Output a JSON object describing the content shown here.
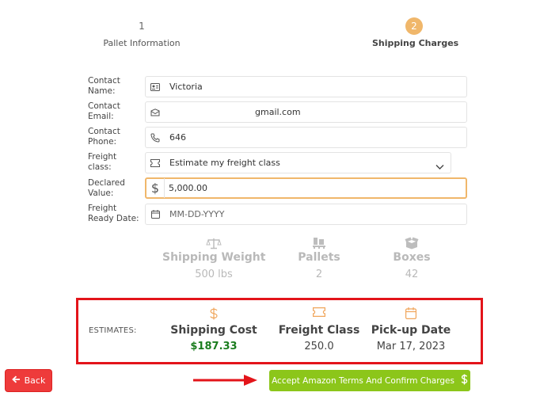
{
  "stepper": {
    "step1": {
      "number": "1",
      "label": "Pallet Information"
    },
    "step2": {
      "number": "2",
      "label": "Shipping Charges"
    }
  },
  "form": {
    "contact_name": {
      "label": "Contact Name:",
      "value": "Victoria",
      "icon": "id-card-icon"
    },
    "contact_email": {
      "label": "Contact Email:",
      "value": "gmail.com",
      "icon": "envelope-icon"
    },
    "contact_phone": {
      "label": "Contact Phone:",
      "value": "646",
      "icon": "phone-icon"
    },
    "freight_class": {
      "label": "Freight class:",
      "value": "Estimate my freight class",
      "icon": "ticket-icon"
    },
    "declared_value": {
      "label": "Declared Value:",
      "value": "5,000.00",
      "prefix": "$"
    },
    "freight_ready_date": {
      "label": "Freight Ready Date:",
      "placeholder": "MM-DD-YYYY",
      "icon": "calendar-icon"
    }
  },
  "summary": {
    "shipping_weight": {
      "title": "Shipping Weight",
      "value": "500 lbs"
    },
    "pallets": {
      "title": "Pallets",
      "value": "2"
    },
    "boxes": {
      "title": "Boxes",
      "value": "42"
    }
  },
  "estimates": {
    "label": "ESTIMATES:",
    "shipping_cost": {
      "title": "Shipping Cost",
      "value": "$187.33"
    },
    "freight_class": {
      "title": "Freight Class",
      "value": "250.0"
    },
    "pickup_date": {
      "title": "Pick-up Date",
      "value": "Mar 17, 2023"
    }
  },
  "buttons": {
    "back": "Back",
    "accept": "Accept Amazon Terms And Confirm Charges"
  },
  "colors": {
    "accent_orange": "#f0b76b",
    "highlight_red": "#e3141a",
    "back_red": "#ee3b3b",
    "accept_green": "#8cc61a",
    "cost_green": "#1b7d1f"
  }
}
